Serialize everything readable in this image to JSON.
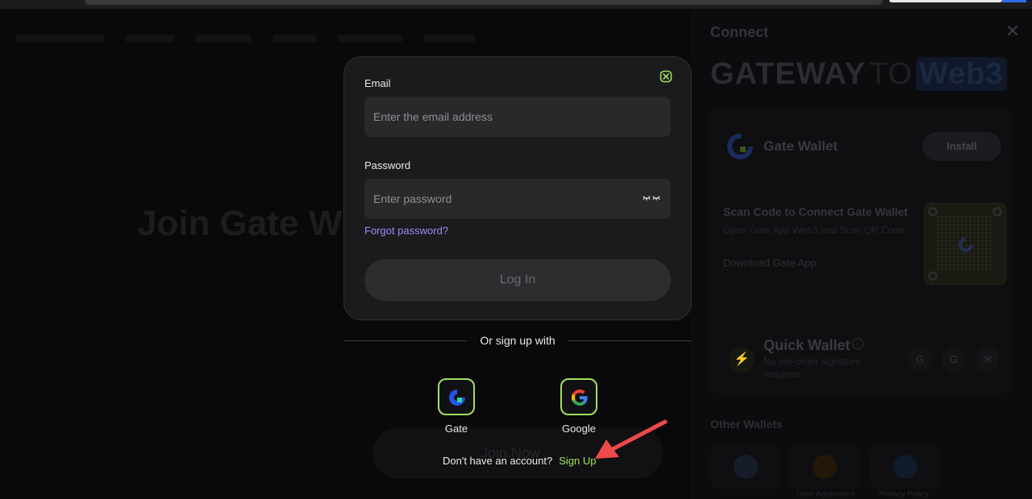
{
  "background_page": {
    "hero_text": "Join Gate W",
    "hero_button_label": "Join Now"
  },
  "connect_drawer": {
    "title": "Connect",
    "banner": {
      "word1": "GATEWAY",
      "word2": "TO",
      "word3": "Web3"
    },
    "gate_wallet": {
      "label": "Gate Wallet",
      "install_label": "Install",
      "scan_title": "Scan Code to Connect Gate Wallet",
      "scan_subtitle": "Open Gate App Web3 and Scan QR Code",
      "download_link": "Download Gate App"
    },
    "quick_wallet": {
      "title": "Quick Wallet",
      "subtitle": "No per-order signature required",
      "options": [
        "G",
        "G",
        "✉"
      ]
    },
    "other_wallets_title": "Other Wallets",
    "legal": {
      "user_agreement": "User Agreement",
      "privacy_policy": "Privacy Policy"
    }
  },
  "login_modal": {
    "email_label": "Email",
    "email_placeholder": "Enter the email address",
    "password_label": "Password",
    "password_placeholder": "Enter password",
    "forgot_password": "Forgot password?",
    "login_button": "Log In",
    "accent_color": "#a3e05d",
    "link_color": "#9b8cf5"
  },
  "alt_signin": {
    "divider_text": "Or sign up with",
    "providers": [
      {
        "label": "Gate",
        "icon": "gate-logo-icon"
      },
      {
        "label": "Google",
        "icon": "google-logo-icon"
      }
    ]
  },
  "signup": {
    "prompt": "Don't have an account?",
    "link": "Sign Up"
  },
  "annotation": {
    "arrow_color": "#ee4a4a"
  }
}
